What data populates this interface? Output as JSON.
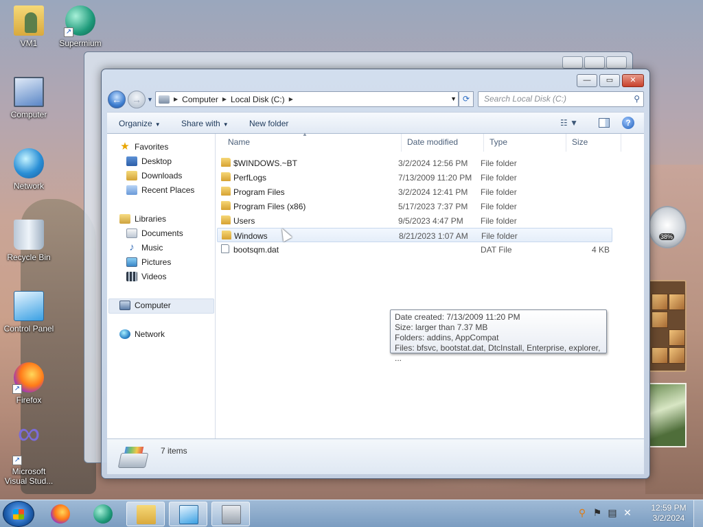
{
  "desktop": {
    "icons": [
      {
        "label": "VM1",
        "icon": "user-folder-icon"
      },
      {
        "label": "Supermium",
        "icon": "supermium-icon"
      },
      {
        "label": "Computer",
        "icon": "computer-icon"
      },
      {
        "label": "Network",
        "icon": "network-icon"
      },
      {
        "label": "Recycle Bin",
        "icon": "recycle-bin-icon"
      },
      {
        "label": "Control Panel",
        "icon": "control-panel-icon"
      },
      {
        "label": "Firefox",
        "icon": "firefox-icon"
      },
      {
        "label": "Microsoft Visual Stud...",
        "icon": "visual-studio-icon"
      }
    ],
    "cpu_gadget_value": "38%"
  },
  "explorer": {
    "window_controls": {
      "minimize": "—",
      "maximize": "▭",
      "close": "✕"
    },
    "address": {
      "crumbs": [
        "Computer",
        "Local Disk (C:)"
      ]
    },
    "search": {
      "placeholder": "Search Local Disk (C:)"
    },
    "toolbar": {
      "organize": "Organize",
      "share_with": "Share with",
      "new_folder": "New folder"
    },
    "nav": {
      "favorites": "Favorites",
      "desktop": "Desktop",
      "downloads": "Downloads",
      "recent_places": "Recent Places",
      "libraries": "Libraries",
      "documents": "Documents",
      "music": "Music",
      "pictures": "Pictures",
      "videos": "Videos",
      "computer": "Computer",
      "network": "Network"
    },
    "columns": {
      "name": "Name",
      "date_modified": "Date modified",
      "type": "Type",
      "size": "Size"
    },
    "files": [
      {
        "name": "$WINDOWS.~BT",
        "date": "3/2/2024 12:56 PM",
        "type": "File folder",
        "size": ""
      },
      {
        "name": "PerfLogs",
        "date": "7/13/2009 11:20 PM",
        "type": "File folder",
        "size": ""
      },
      {
        "name": "Program Files",
        "date": "3/2/2024 12:41 PM",
        "type": "File folder",
        "size": ""
      },
      {
        "name": "Program Files (x86)",
        "date": "5/17/2023 7:37 PM",
        "type": "File folder",
        "size": ""
      },
      {
        "name": "Users",
        "date": "9/5/2023 4:47 PM",
        "type": "File folder",
        "size": ""
      },
      {
        "name": "Windows",
        "date": "8/21/2023 1:07 AM",
        "type": "File folder",
        "size": ""
      },
      {
        "name": "bootsqm.dat",
        "date": "",
        "type": "DAT File",
        "size": "4 KB"
      }
    ],
    "tooltip": {
      "line1": "Date created: 7/13/2009 11:20 PM",
      "line2": "Size: larger than 7.37 MB",
      "line3": "Folders: addins, AppCompat",
      "line4": "Files: bfsvc, bootstat.dat, DtcInstall, Enterprise, explorer, ..."
    },
    "status": {
      "item_count": "7 items"
    }
  },
  "taskbar": {
    "clock_time": "12:59 PM",
    "clock_date": "3/2/2024"
  }
}
